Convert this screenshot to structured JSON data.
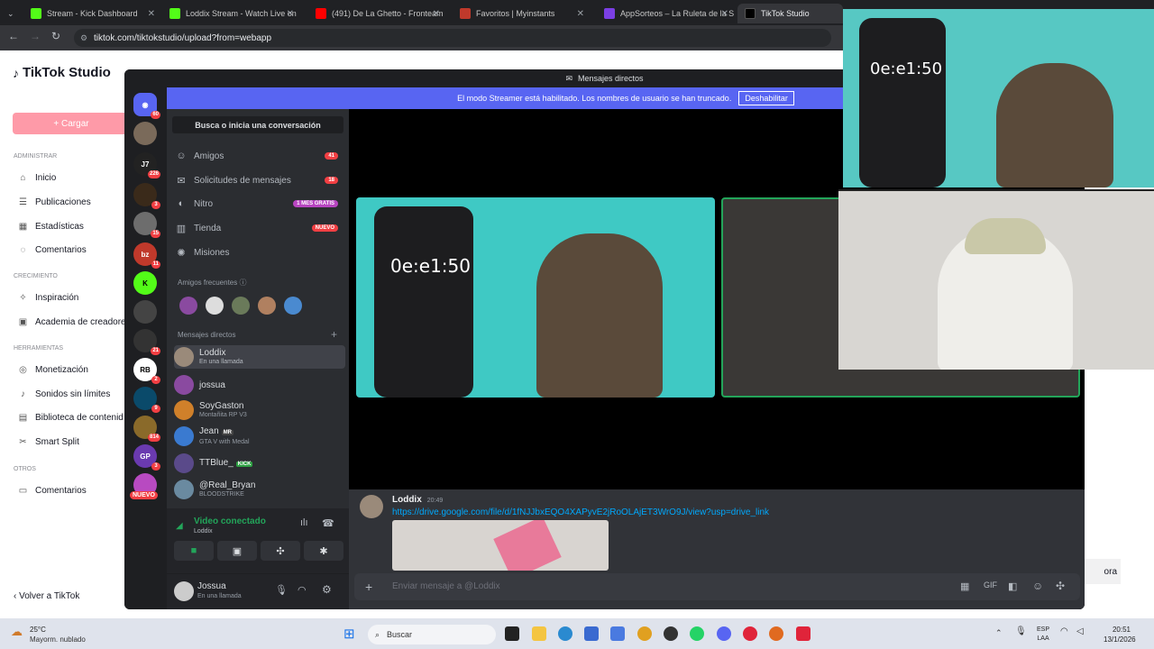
{
  "browser": {
    "tabs": [
      {
        "title": "Stream - Kick Dashboard",
        "color": "#53fc18"
      },
      {
        "title": "Loddix Stream - Watch Live on",
        "color": "#53fc18"
      },
      {
        "title": "(491) De La Ghetto - Fronteam",
        "color": "#ff0000"
      },
      {
        "title": "Favoritos | Myinstants",
        "color": "#c0392b"
      },
      {
        "title": "AppSorteos – La Ruleta de la S",
        "color": "#7b3fe4"
      },
      {
        "title": "TikTok Studio",
        "color": "#000000"
      }
    ],
    "url": "tiktok.com/tiktokstudio/upload?from=webapp"
  },
  "tiktok": {
    "logo": "TikTok Studio",
    "upload_label": "+ Cargar",
    "sections": [
      {
        "header": "ADMINISTRAR",
        "items": [
          "Inicio",
          "Publicaciones",
          "Estadísticas",
          "Comentarios"
        ]
      },
      {
        "header": "CRECIMIENTO",
        "items": [
          "Inspiración",
          "Academia de creadore"
        ]
      },
      {
        "header": "HERRAMIENTAS",
        "items": [
          "Monetización",
          "Sonidos sin límites",
          "Biblioteca de contenid",
          "Smart Split"
        ]
      },
      {
        "header": "OTROS",
        "items": [
          "Comentarios"
        ]
      }
    ],
    "back": "‹  Volver a TikTok",
    "right_button": "ora"
  },
  "discord": {
    "title": "Mensajes directos",
    "banner": "El modo Streamer está habilitado. Los nombres de usuario se han truncado.",
    "banner_button": "Deshabilitar",
    "server_badges": [
      "60",
      "",
      "226",
      "3",
      "15",
      "11",
      "",
      "",
      "21",
      "2",
      "9",
      "814",
      "3",
      "NUEVO"
    ],
    "search": "Busca o inicia una conversación",
    "nav": [
      {
        "label": "Amigos",
        "pill": "41"
      },
      {
        "label": "Solicitudes de mensajes",
        "pill": "18"
      },
      {
        "label": "Nitro",
        "pill": "1 MES GRATIS"
      },
      {
        "label": "Tienda",
        "pill": "NUEVO"
      },
      {
        "label": "Misiones",
        "pill": ""
      }
    ],
    "frequent_header": "Amigos frecuentes",
    "dm_header": "Mensajes directos",
    "dms": [
      {
        "name": "Loddix",
        "sub": "En una llamada",
        "tag": ""
      },
      {
        "name": "jossua",
        "sub": "",
        "tag": ""
      },
      {
        "name": "SoyGaston",
        "sub": "Montañita RP V3",
        "tag": ""
      },
      {
        "name": "Jean",
        "sub": "GTA V with Medal",
        "tag": "MR"
      },
      {
        "name": "TTBlue_",
        "sub": "",
        "tag": "KICK"
      },
      {
        "name": "@Real_Bryan",
        "sub": "BLOODSTRIKE",
        "tag": ""
      }
    ],
    "voice": {
      "status": "Video conectado",
      "channel": "Loddix"
    },
    "user": {
      "name": "Jossua",
      "sub": "En una llamada"
    },
    "message": {
      "author": "Loddix",
      "time": "20:49",
      "link": "https://drive.google.com/file/d/1fNJJbxEQO4XAPyvE2jRoOLAjET3WrO9J/view?usp=drive_link"
    },
    "input_placeholder": "Enviar mensaje a @Loddix",
    "phone_timer": "0e:e1:50"
  },
  "taskbar": {
    "weather_temp": "25°C",
    "weather_desc": "Mayorm. nublado",
    "search": "Buscar",
    "lang1": "ESP",
    "lang2": "LAA",
    "time": "20:51",
    "date": "13/1/2026"
  }
}
